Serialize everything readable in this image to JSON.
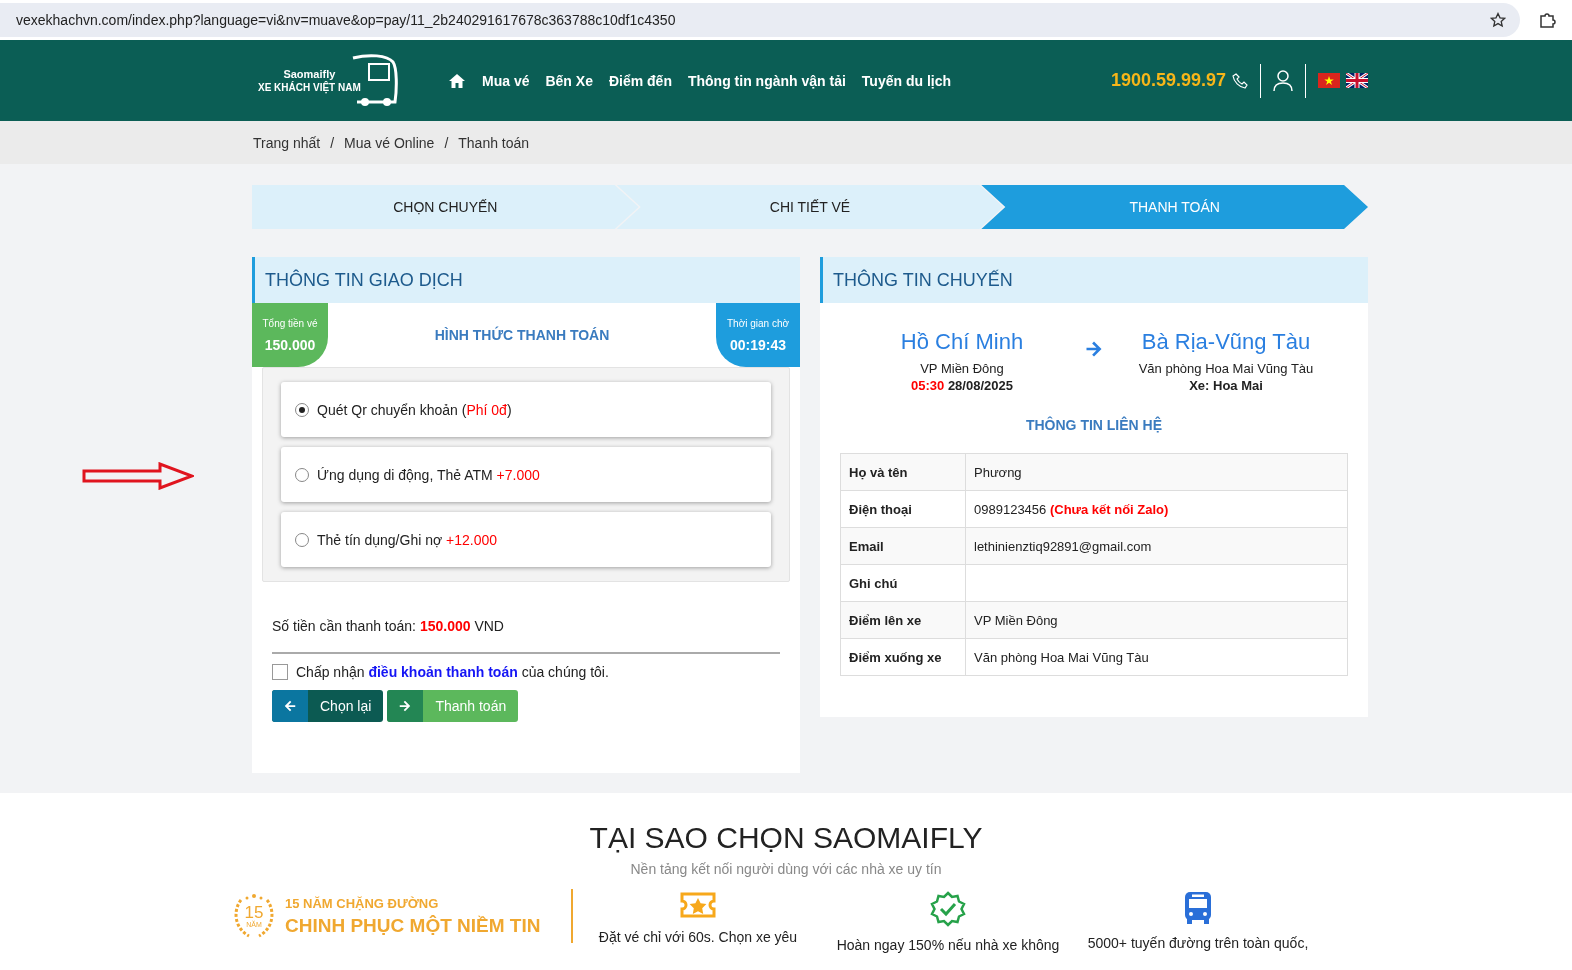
{
  "browser": {
    "url": "vexekhachvn.com/index.php?language=vi&nv=muave&op=pay/11_2b240291617678c363788c10df1c4350"
  },
  "header": {
    "logo": {
      "brand": "Saomaifly",
      "tagline": "XE KHÁCH VIỆT NAM"
    },
    "nav": [
      "Mua vé",
      "Bến Xe",
      "Điểm đến",
      "Thông tin ngành vận tải",
      "Tuyến du lịch"
    ],
    "hotline": "1900.59.99.97"
  },
  "breadcrumb": {
    "items": [
      "Trang nhất",
      "Mua vé Online",
      "Thanh toán"
    ],
    "separators": [
      "/",
      "/"
    ]
  },
  "steps": [
    {
      "label": "CHỌN CHUYẾN",
      "selected": false
    },
    {
      "label": "CHI TIẾT VÉ",
      "selected": false
    },
    {
      "label": "THANH TOÁN",
      "selected": true
    }
  ],
  "transaction": {
    "title": "THÔNG TIN GIAO DỊCH",
    "total": {
      "label": "Tổng tiền vé",
      "value": "150.000"
    },
    "countdown": {
      "label": "Thời gian chờ",
      "value": "00:19:43"
    },
    "method_title": "HÌNH THỨC THANH TOÁN",
    "options": [
      {
        "label": "Quét Qr chuyển khoản (",
        "fee": "Phí 0đ",
        "label_end": ")",
        "selected": true
      },
      {
        "label": "Ứng dụng di động, Thẻ ATM ",
        "fee": "+7.000",
        "selected": false
      },
      {
        "label": "Thẻ tín dụng/Ghi nợ ",
        "fee": "+12.000",
        "selected": false
      }
    ],
    "amount": {
      "prefix": "Số tiền cần thanh toán: ",
      "value": "150.000",
      "suffix": " VND"
    },
    "terms": {
      "prefix": "Chấp nhận ",
      "link": "điều khoản thanh toán",
      "suffix": " của chúng tôi.",
      "checked": false
    },
    "buttons": [
      {
        "kind": "back",
        "label": "Chọn lại"
      },
      {
        "kind": "next",
        "label": "Thanh toán"
      }
    ]
  },
  "trip": {
    "title": "THÔNG TIN CHUYẾN",
    "from": {
      "city": "Hồ Chí Minh",
      "station": "VP Miền Đông",
      "time": "05:30",
      "date": "28/08/2025"
    },
    "to": {
      "city": "Bà Rịa-Vũng Tàu",
      "station": "Văn phòng Hoa Mai Vũng Tàu",
      "vehicle": "Xe: Hoa Mai"
    },
    "contact_title": "THÔNG TIN LIÊN HỆ",
    "contact": [
      {
        "label": "Họ và tên",
        "value": "Phương"
      },
      {
        "label": "Điện thoại",
        "value": "0989123456 ",
        "note": "(Chưa kết nối Zalo)"
      },
      {
        "label": "Email",
        "value": "lethinienztiq92891@gmail.com"
      },
      {
        "label": "Ghi chú"
      },
      {
        "label": "Điểm lên xe",
        "value": "VP Miền Đông"
      },
      {
        "label": "Điểm xuống xe",
        "value": "Văn phòng Hoa Mai Vũng Tàu"
      }
    ]
  },
  "why": {
    "title": "TẠI SAO CHỌN SAOMAIFLY",
    "subtitle": "Nền tảng kết nối người dùng với các nhà xe uy tín",
    "badge": {
      "years": "15",
      "unit": "NĂM",
      "line1": "15 NĂM CHẶNG ĐƯỜNG",
      "line2": "CHINH PHỤC MỘT NIỀM TIN"
    },
    "features": [
      {
        "kind": "ticket",
        "text": "Đặt vé chỉ với 60s. Chọn xe yêu"
      },
      {
        "kind": "verified",
        "text": "Hoàn ngay 150% nếu nhà xe không"
      },
      {
        "kind": "bus",
        "text": "5000+ tuyến đường trên toàn quốc,"
      }
    ]
  }
}
